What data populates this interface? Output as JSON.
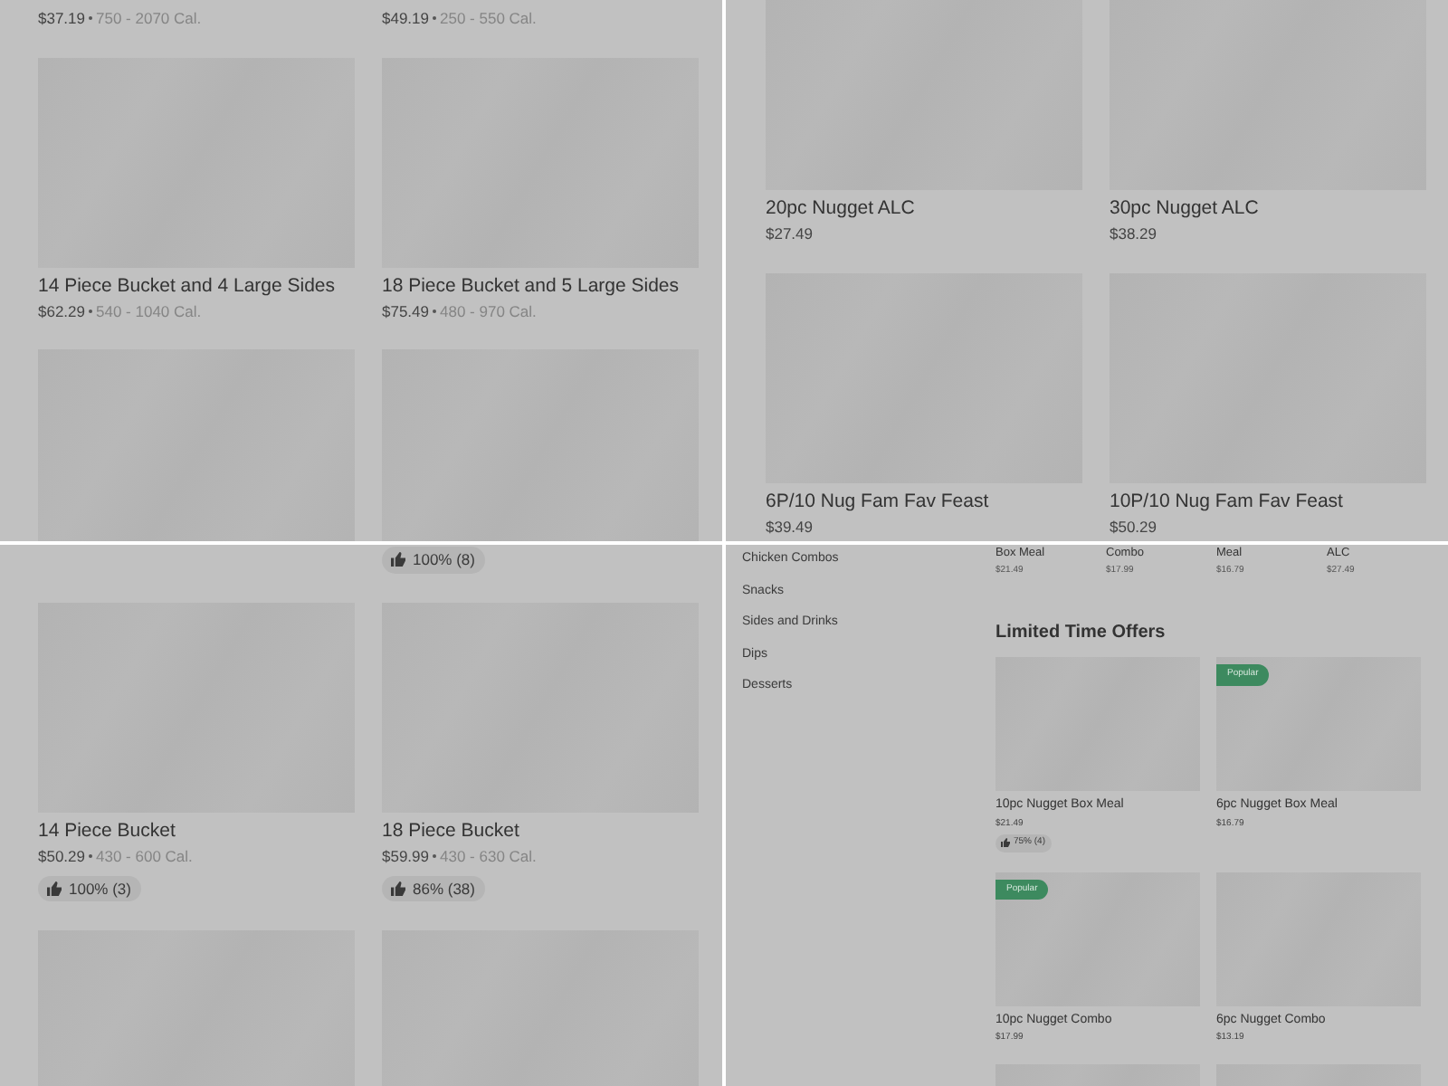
{
  "panels": [
    {
      "kind": "grid",
      "rows": [
        {
          "items": [
            {
              "kind": "text",
              "price": "$37.19",
              "calories": "750 - 2070 Cal."
            },
            {
              "kind": "text",
              "price": "$49.19",
              "calories": "250 - 550 Cal."
            }
          ]
        },
        {
          "items": [
            {
              "kind": "full",
              "title": "14 Piece Bucket and 4 Large Sides",
              "price": "$62.29",
              "calories": "540 - 1040 Cal."
            },
            {
              "kind": "full",
              "title": "18 Piece Bucket and 5 Large Sides",
              "price": "$75.49",
              "calories": "480 - 970 Cal."
            }
          ]
        },
        {
          "items": [
            {
              "kind": "image"
            },
            {
              "kind": "image"
            }
          ]
        }
      ]
    },
    {
      "kind": "grid",
      "rows": [
        {
          "items": [
            {
              "kind": "full",
              "title": "20pc Nugget ALC",
              "price": "$27.49"
            },
            {
              "kind": "full",
              "title": "30pc Nugget ALC",
              "price": "$38.29"
            }
          ]
        },
        {
          "items": [
            {
              "kind": "full",
              "title": "6P/10 Nug Fam Fav Feast",
              "price": "$39.49"
            },
            {
              "kind": "full",
              "title": "10P/10 Nug Fam Fav Feast",
              "price": "$50.29"
            }
          ]
        }
      ]
    },
    {
      "kind": "grid",
      "rows": [
        {
          "items": [
            {
              "kind": "none"
            },
            {
              "kind": "rating",
              "rating": "100% (8)"
            }
          ]
        },
        {
          "items": [
            {
              "kind": "full",
              "title": "14 Piece Bucket",
              "price": "$50.29",
              "calories": "430 - 600 Cal.",
              "rating": "100% (3)"
            },
            {
              "kind": "full",
              "title": "18 Piece Bucket",
              "price": "$59.99",
              "calories": "430 - 630 Cal.",
              "rating": "86% (38)"
            }
          ]
        },
        {
          "items": [
            {
              "kind": "image"
            },
            {
              "kind": "image"
            }
          ]
        }
      ]
    },
    {
      "kind": "menu",
      "sidebar": {
        "items": [
          "Chicken Combos",
          "Snacks",
          "Sides and Drinks",
          "Dips",
          "Desserts"
        ]
      },
      "top_row": [
        {
          "title": "Box Meal",
          "price": "$21.49"
        },
        {
          "title": "Combo",
          "price": "$17.99"
        },
        {
          "title": "Meal",
          "price": "$16.79"
        },
        {
          "title": "ALC",
          "price": "$27.49"
        }
      ],
      "section": {
        "heading": "Limited Time Offers",
        "rows": [
          {
            "items": [
              {
                "kind": "full",
                "title": "10pc Nugget Box Meal",
                "price": "$21.49",
                "rating": "75% (4)"
              },
              {
                "kind": "full",
                "badge": "Popular",
                "title": "6pc Nugget Box Meal",
                "price": "$16.79"
              }
            ]
          },
          {
            "items": [
              {
                "kind": "full",
                "badge": "Popular",
                "title": "10pc Nugget Combo",
                "price": "$17.99"
              },
              {
                "kind": "full",
                "title": "6pc Nugget Combo",
                "price": "$13.19"
              }
            ]
          },
          {
            "items": [
              {
                "kind": "image"
              },
              {
                "kind": "image"
              }
            ]
          }
        ]
      }
    }
  ]
}
